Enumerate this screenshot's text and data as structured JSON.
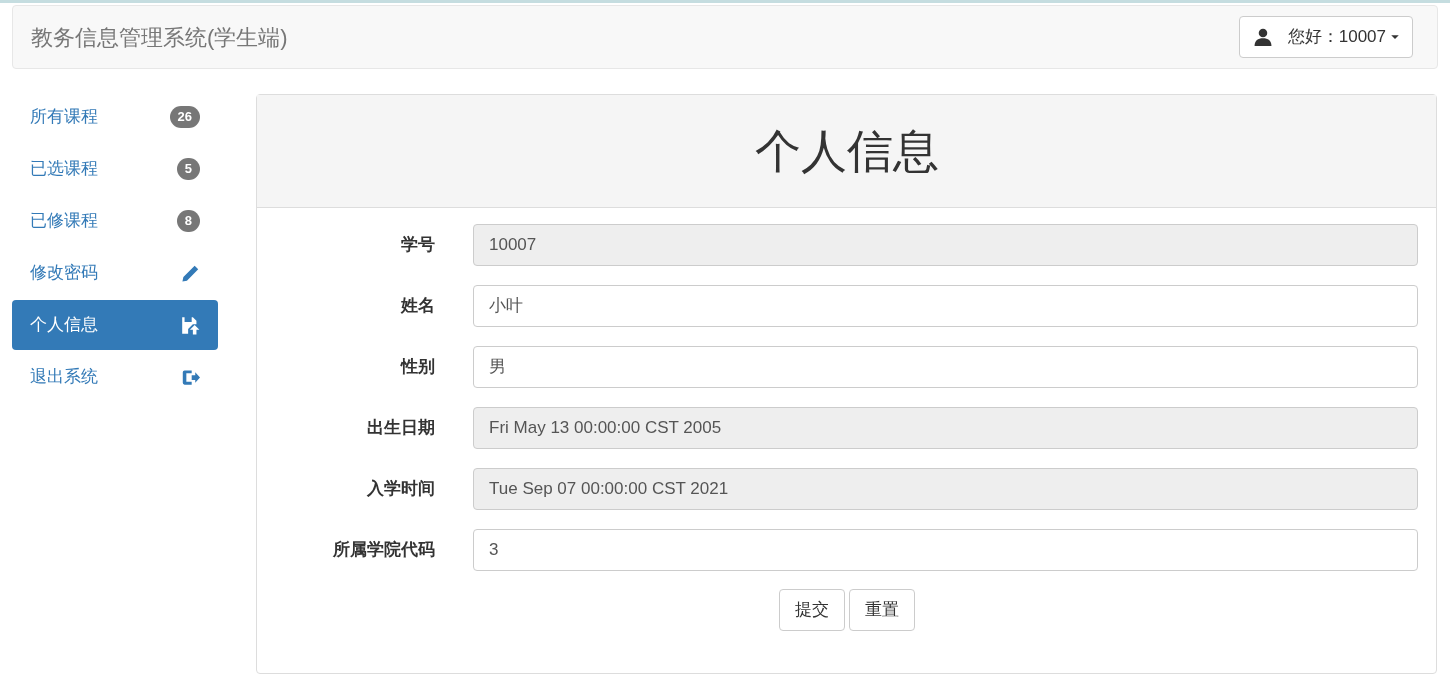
{
  "navbar": {
    "brand": "教务信息管理系统(学生端)",
    "user_menu": "您好：10007"
  },
  "sidebar": {
    "items": [
      {
        "label": "所有课程",
        "kind": "badge",
        "badge": "26",
        "selected": false
      },
      {
        "label": "已选课程",
        "kind": "badge",
        "badge": "5",
        "selected": false
      },
      {
        "label": "已修课程",
        "kind": "badge",
        "badge": "8",
        "selected": false
      },
      {
        "label": "修改密码",
        "kind": "edit",
        "selected": false
      },
      {
        "label": "个人信息",
        "kind": "save",
        "selected": true
      },
      {
        "label": "退出系统",
        "kind": "exit",
        "selected": false
      }
    ]
  },
  "panel": {
    "title": "个人信息",
    "fields": [
      {
        "label": "学号",
        "value": "10007",
        "readonly": true
      },
      {
        "label": "姓名",
        "value": "小叶",
        "readonly": false
      },
      {
        "label": "性别",
        "value": "男",
        "readonly": false
      },
      {
        "label": "出生日期",
        "value": "Fri May 13 00:00:00 CST 2005",
        "readonly": true
      },
      {
        "label": "入学时间",
        "value": "Tue Sep 07 00:00:00 CST 2021",
        "readonly": true
      },
      {
        "label": "所属学院代码",
        "value": "3",
        "readonly": false
      }
    ],
    "buttons": [
      "提交",
      "重置"
    ]
  }
}
